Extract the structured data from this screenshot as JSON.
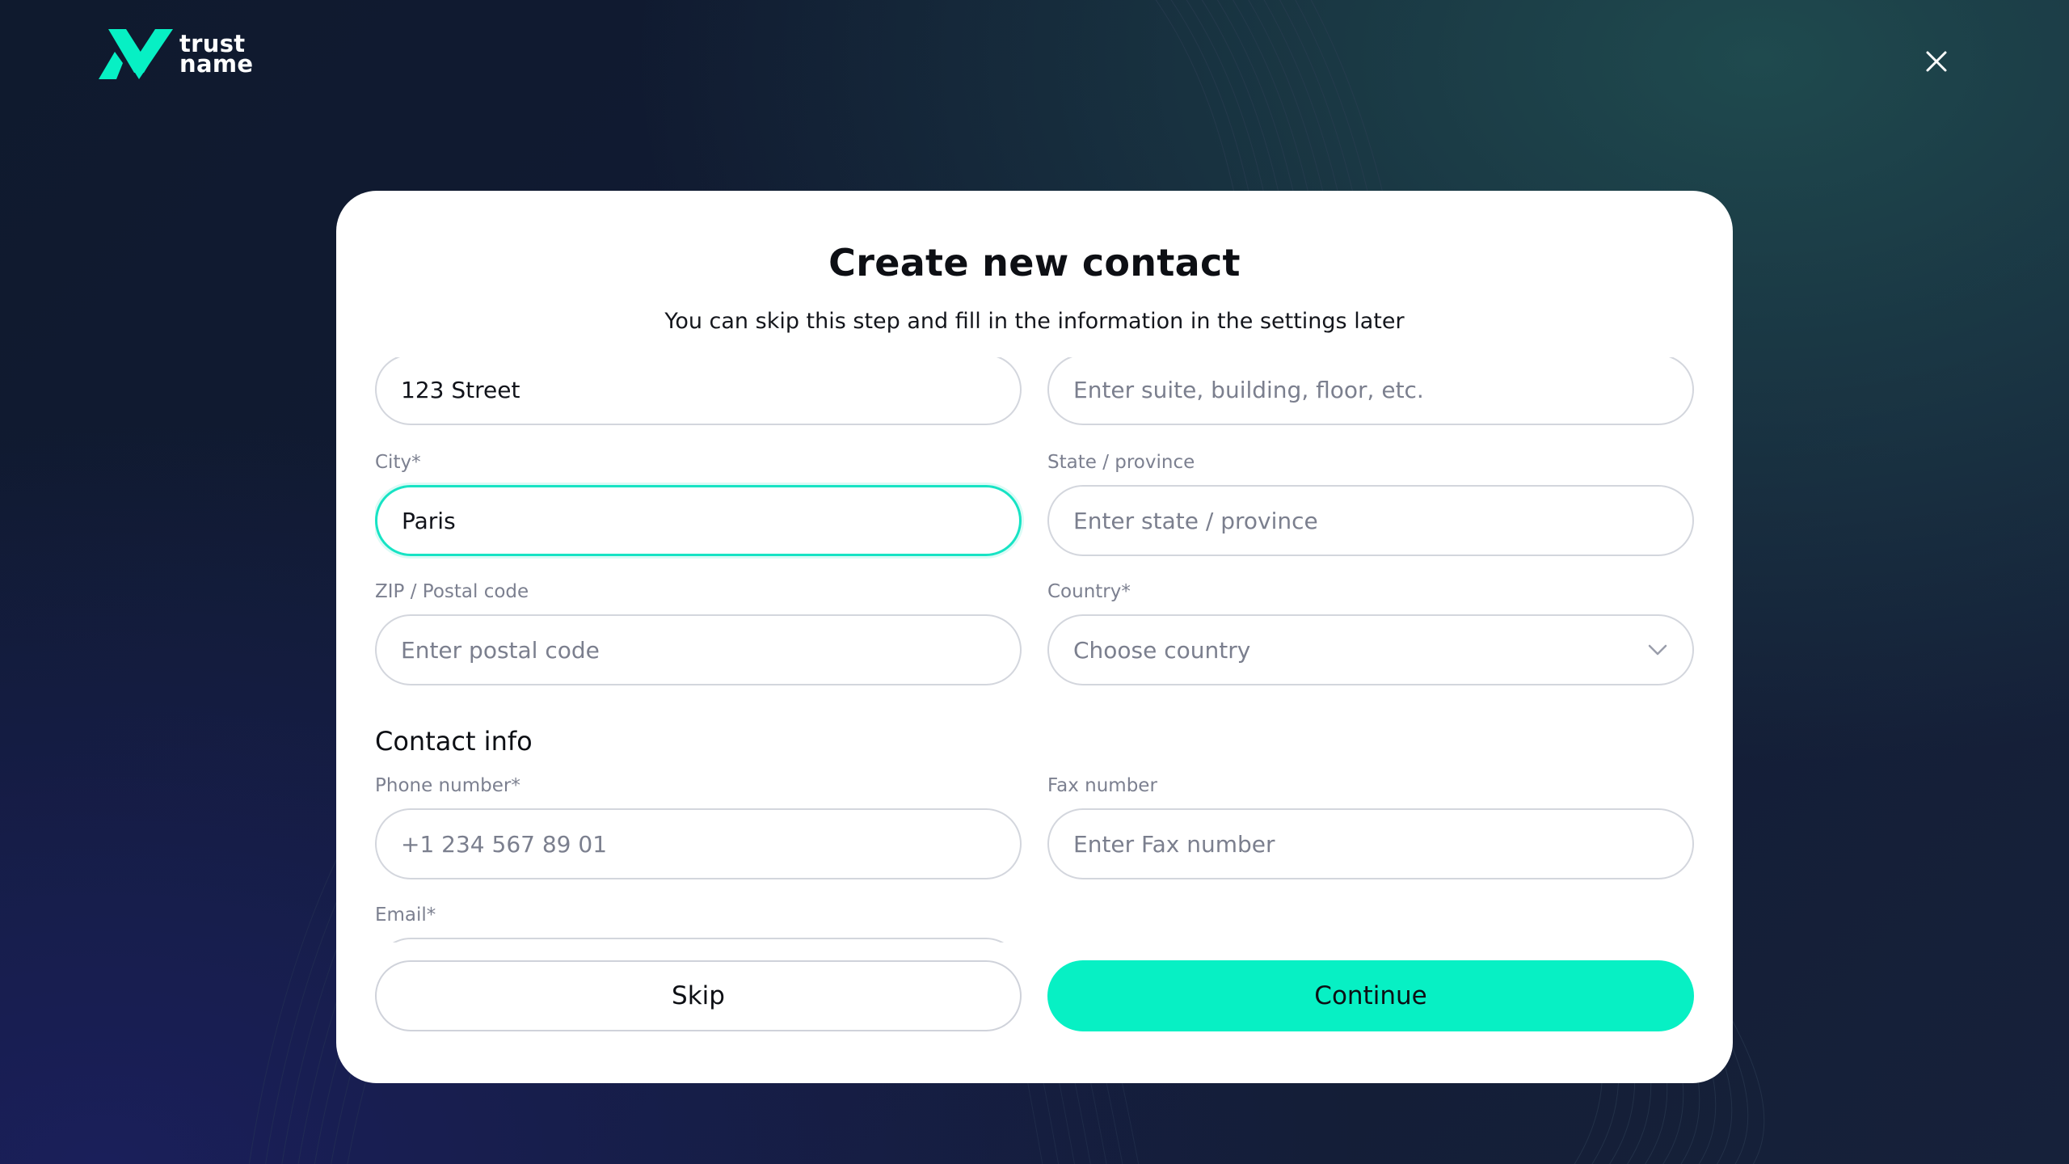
{
  "brand": {
    "name_line1": "trust",
    "name_line2": "name",
    "accent_color": "#07f0c4",
    "logo_icon": "trustname-logo-icon"
  },
  "header": {
    "close_icon": "close-icon"
  },
  "modal": {
    "title": "Create new contact",
    "subtitle": "You can skip this step and fill in the information in the settings later"
  },
  "address": {
    "street": {
      "value": "123 Street"
    },
    "suite": {
      "placeholder": "Enter suite, building, floor, etc.",
      "value": ""
    },
    "city": {
      "label": "City*",
      "value": "Paris"
    },
    "state": {
      "label": "State / province",
      "placeholder": "Enter state / province",
      "value": ""
    },
    "zip": {
      "label": "ZIP / Postal code",
      "placeholder": "Enter postal code",
      "value": ""
    },
    "country": {
      "label": "Country*",
      "selected": "Choose country",
      "icon": "chevron-down-icon"
    }
  },
  "contact_info": {
    "section_title": "Contact info",
    "phone": {
      "label": "Phone number*",
      "placeholder": "+1 234 567 89 01",
      "value": ""
    },
    "fax": {
      "label": "Fax number",
      "placeholder": "Enter Fax number",
      "value": ""
    },
    "email": {
      "label": "Email*"
    }
  },
  "actions": {
    "skip_label": "Skip",
    "continue_label": "Continue"
  }
}
